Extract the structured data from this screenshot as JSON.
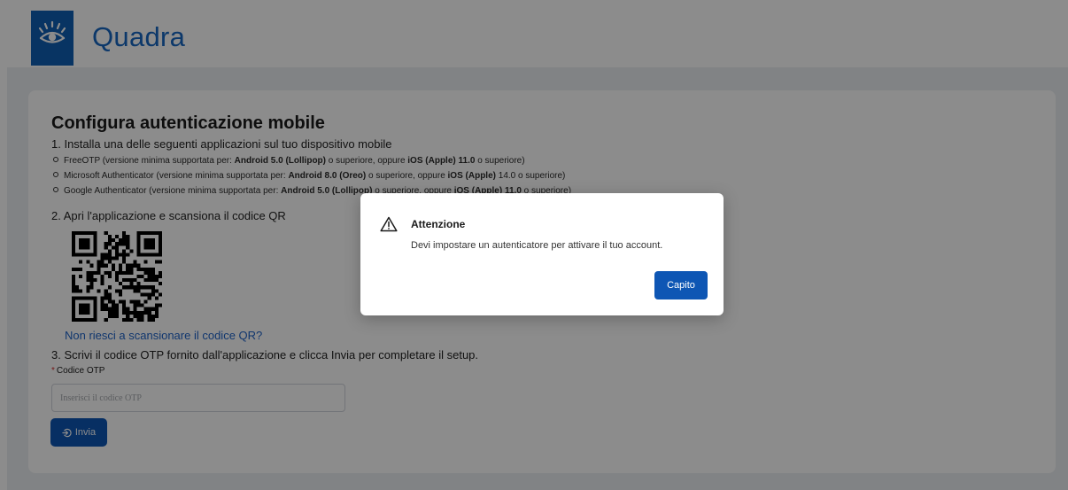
{
  "header": {
    "brand": "Quadra",
    "logo_icon": "eye-icon"
  },
  "setup": {
    "title": "Configura autenticazione mobile",
    "step1": "1. Installa una delle seguenti applicazioni sul tuo dispositivo mobile",
    "apps": [
      {
        "pre": "FreeOTP (versione minima supportata per: ",
        "android": "Android 5.0 (Lollipop)",
        "mid": " o superiore, oppure ",
        "ios": "iOS (Apple) 11.0",
        "post": " o superiore)"
      },
      {
        "pre": "Microsoft Authenticator (versione minima supportata per: ",
        "android": "Android 8.0 (Oreo)",
        "mid": " o superiore, oppure ",
        "ios": "iOS (Apple)",
        "post": " 14.0 o superiore)"
      },
      {
        "pre": "Google Authenticator (versione minima supportata per: ",
        "android": "Android 5.0 (Lollipop)",
        "mid": " o superiore, oppure ",
        "ios": "iOS (Apple) 11.0",
        "post": " o superiore)"
      }
    ],
    "step2": "2. Apri l'applicazione e scansiona il codice QR",
    "qr_link": "Non riesci a scansionare il codice QR?",
    "step3": "3. Scrivi il codice OTP fornito dall'applicazione e clicca Invia per completare il setup.",
    "otp_required_mark": "*",
    "otp_label": "Codice OTP",
    "otp_value": "",
    "otp_placeholder": "Inserisci il codice OTP",
    "send_label": "Invia",
    "send_icon": "login-arrow-icon"
  },
  "modal": {
    "icon": "warning-icon",
    "title": "Attenzione",
    "message": "Devi impostare un autenticatore per attivare il tuo account.",
    "button": "Capito"
  },
  "colors": {
    "brand": "#1766c2",
    "primary_button": "#0e56b4",
    "link": "#1e63c9",
    "required": "#d32f2f"
  }
}
